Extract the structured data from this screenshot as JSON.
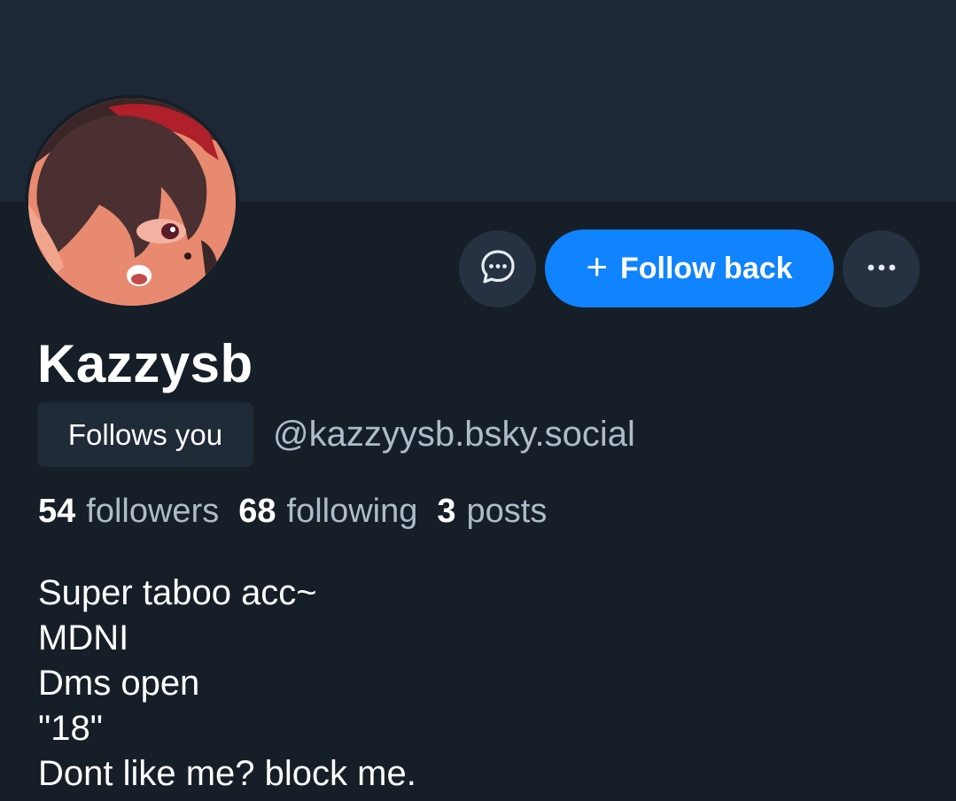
{
  "profile": {
    "display_name": "Kazzysb",
    "handle": "@kazzyysb.bsky.social",
    "follows_you_label": "Follows you",
    "avatar_icon": "avatar-image"
  },
  "actions": {
    "message_icon": "chat-bubble-icon",
    "follow_icon": "plus-icon",
    "follow_plus": "+",
    "follow_label": "Follow back",
    "more_icon": "ellipsis-icon"
  },
  "stats": {
    "followers_count": "54",
    "followers_label": "followers",
    "following_count": "68",
    "following_label": "following",
    "posts_count": "3",
    "posts_label": "posts"
  },
  "bio": {
    "lines": [
      "Super taboo acc~",
      "MDNI",
      "Dms open",
      "\"18\"",
      "Dont like me? block me."
    ]
  },
  "colors": {
    "background": "#161e27",
    "banner": "#1d2836",
    "accent": "#1083fe",
    "icon_button": "#263241",
    "secondary_text": "#aebbc9"
  }
}
